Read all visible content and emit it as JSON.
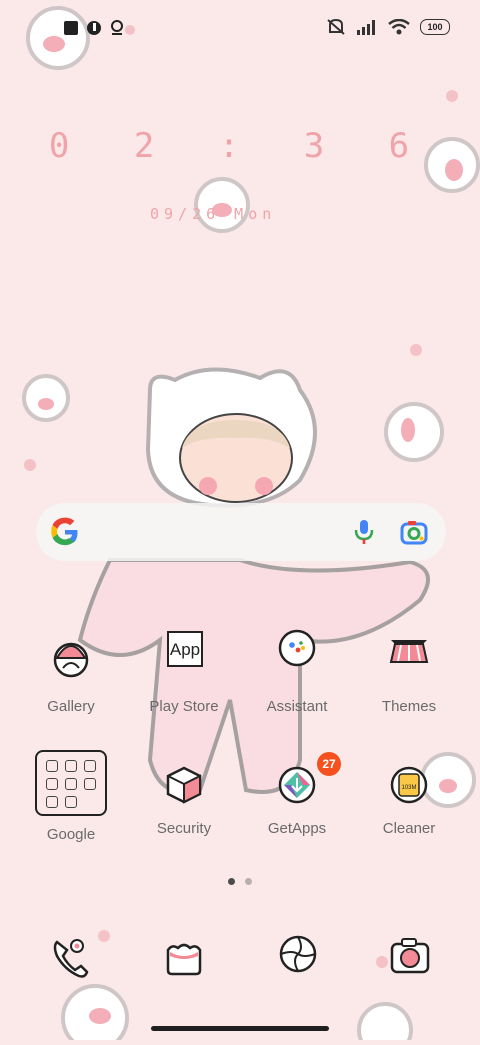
{
  "status_bar": {
    "left_icons": [
      "notification-square-icon",
      "app-notification-icon",
      "location-pin-icon"
    ],
    "right_icons": [
      "silent-icon",
      "signal-icon",
      "wifi-icon",
      "battery-icon"
    ],
    "battery_level": "100"
  },
  "clock": {
    "time": "0 2 : 3 6",
    "date": "09/26 Mon"
  },
  "search": {
    "icons": [
      "google-logo-icon",
      "microphone-icon",
      "lens-camera-icon"
    ]
  },
  "apps": [
    {
      "label": "Gallery",
      "icon": "gallery-icon"
    },
    {
      "label": "Play Store",
      "icon": "play-store-icon",
      "icon_text": "App"
    },
    {
      "label": "Assistant",
      "icon": "assistant-icon"
    },
    {
      "label": "Themes",
      "icon": "themes-icon"
    },
    {
      "label": "Google",
      "icon": "folder-icon"
    },
    {
      "label": "Security",
      "icon": "security-icon"
    },
    {
      "label": "GetApps",
      "icon": "getapps-icon",
      "badge": "27"
    },
    {
      "label": "Cleaner",
      "icon": "cleaner-icon",
      "icon_text": "103M"
    }
  ],
  "page_indicator": {
    "pages": 2,
    "current": 1
  },
  "dock": [
    {
      "icon": "phone-icon"
    },
    {
      "icon": "messages-icon"
    },
    {
      "icon": "browser-icon"
    },
    {
      "icon": "camera-icon"
    }
  ],
  "colors": {
    "background": "#fbe9ea",
    "accent_pink": "#f0a3a9",
    "badge": "#f4511e"
  }
}
